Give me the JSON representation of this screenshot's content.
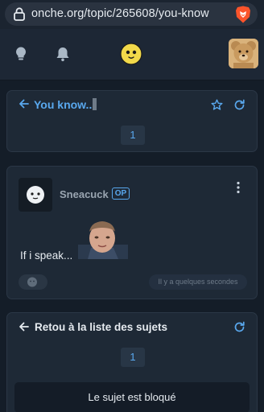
{
  "browser": {
    "url": "onche.org/topic/265608/you-know"
  },
  "topic": {
    "title": "You know..",
    "page": "1"
  },
  "post": {
    "username": "Sneacuck",
    "op_badge": "OP",
    "text": "If i speak...",
    "timestamp": "Il y a quelques secondes"
  },
  "footer": {
    "back_label": "Retou à la liste des sujets",
    "page": "1",
    "locked_message": "Le sujet est bloqué"
  },
  "icons": {
    "lock": "lock-icon",
    "brave": "brave-lion-icon",
    "bulb": "lightbulb-icon",
    "bell": "bell-icon",
    "logo": "smiley-logo-icon",
    "back": "arrow-left-icon",
    "star": "star-icon",
    "refresh": "refresh-icon",
    "menu": "vertical-dots-icon",
    "react": "sticker-react-icon"
  },
  "colors": {
    "accent": "#59a8ee",
    "background": "#141d28",
    "card": "#1e2936"
  }
}
